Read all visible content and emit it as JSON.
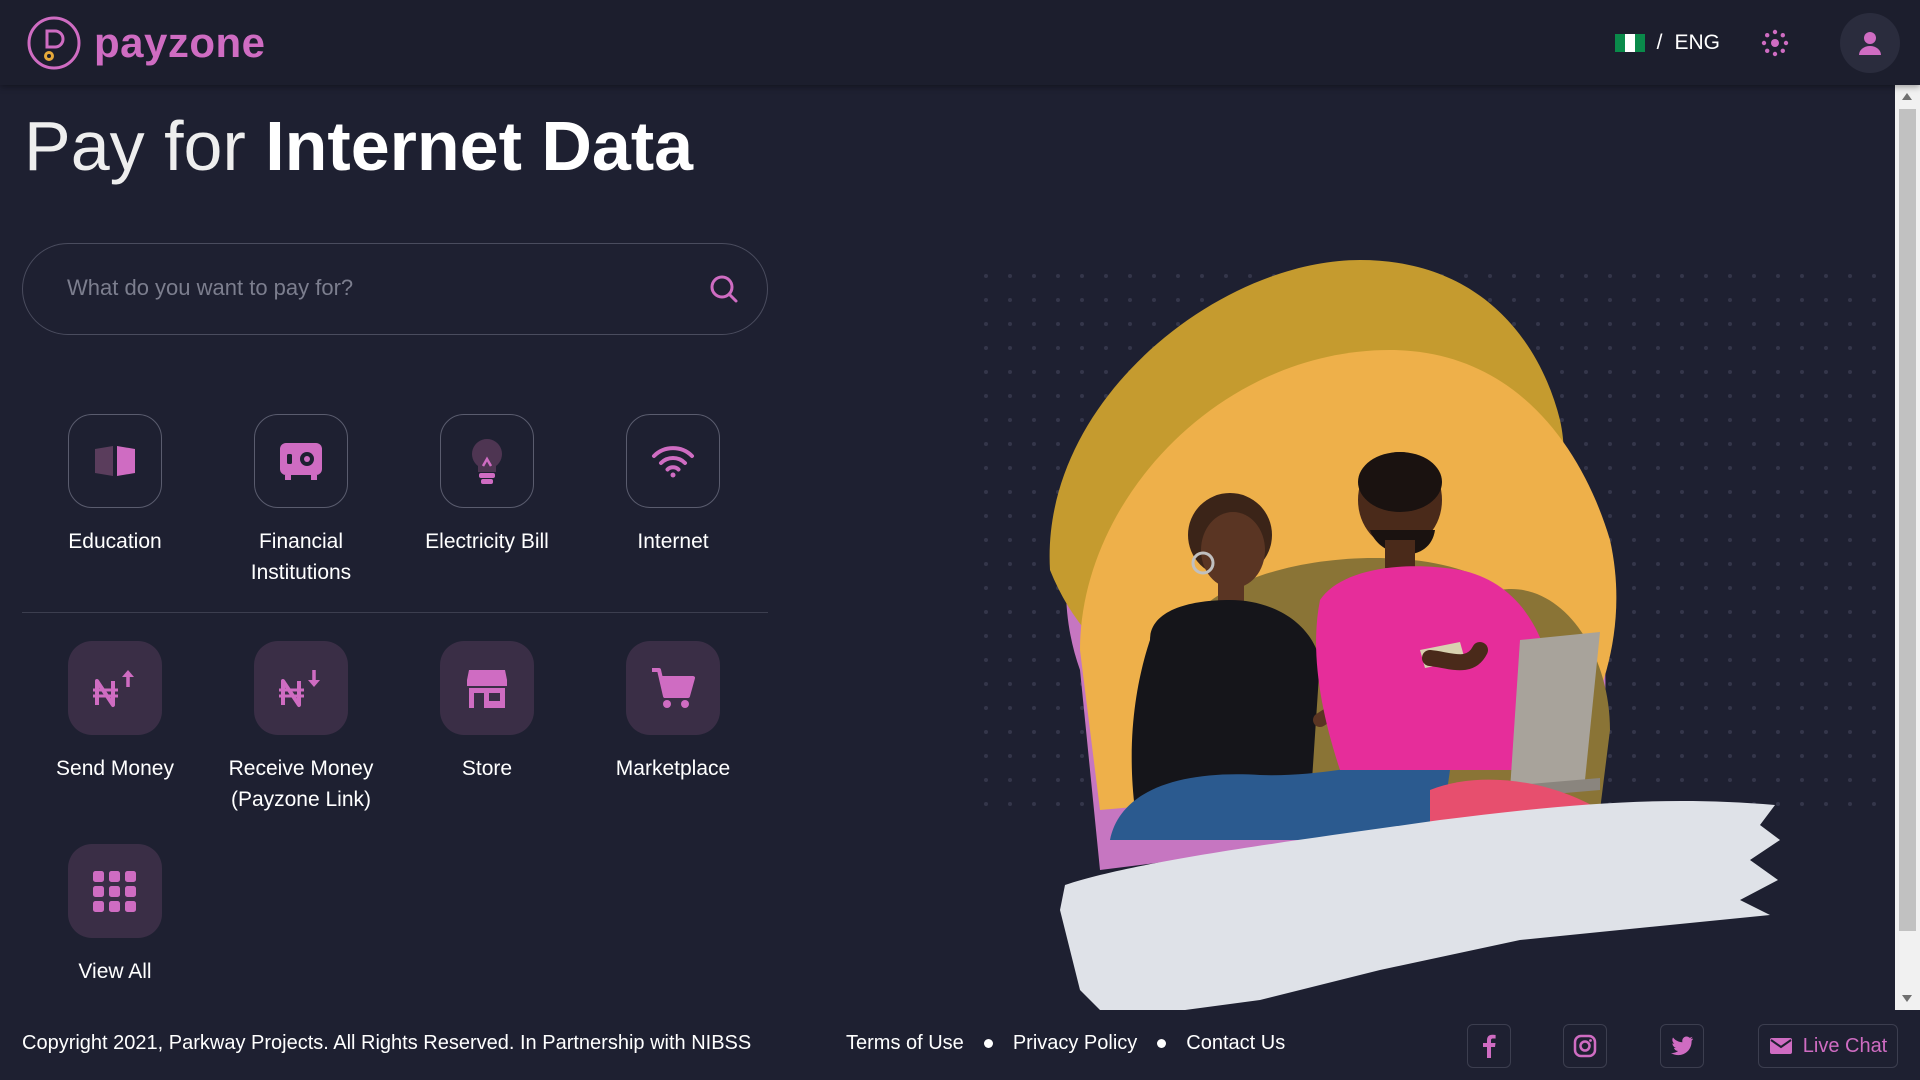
{
  "brand": {
    "name": "payzone",
    "color": "#cf6cc2"
  },
  "header": {
    "language": "ENG",
    "separator": "/"
  },
  "page": {
    "title_light": "Pay for",
    "title_bold": "Internet Data"
  },
  "search": {
    "placeholder": "What do you want to pay for?"
  },
  "categories": [
    {
      "label": "Education",
      "icon": "book-icon"
    },
    {
      "label": "Financial Institutions",
      "icon": "safe-icon"
    },
    {
      "label": "Electricity Bill",
      "icon": "lightbulb-icon"
    },
    {
      "label": "Internet",
      "icon": "wifi-icon"
    }
  ],
  "services": [
    {
      "label": "Send Money",
      "icon": "naira-send-icon"
    },
    {
      "label": "Receive Money (Payzone Link)",
      "icon": "naira-receive-icon"
    },
    {
      "label": "Store",
      "icon": "store-icon"
    },
    {
      "label": "Marketplace",
      "icon": "cart-icon"
    },
    {
      "label": "View All",
      "icon": "grid-icon"
    }
  ],
  "footer": {
    "copyright": "Copyright 2021, Parkway Projects. All Rights Reserved. In Partnership with NIBSS",
    "links": [
      "Terms of Use",
      "Privacy Policy",
      "Contact Us"
    ],
    "live_chat": "Live Chat"
  }
}
